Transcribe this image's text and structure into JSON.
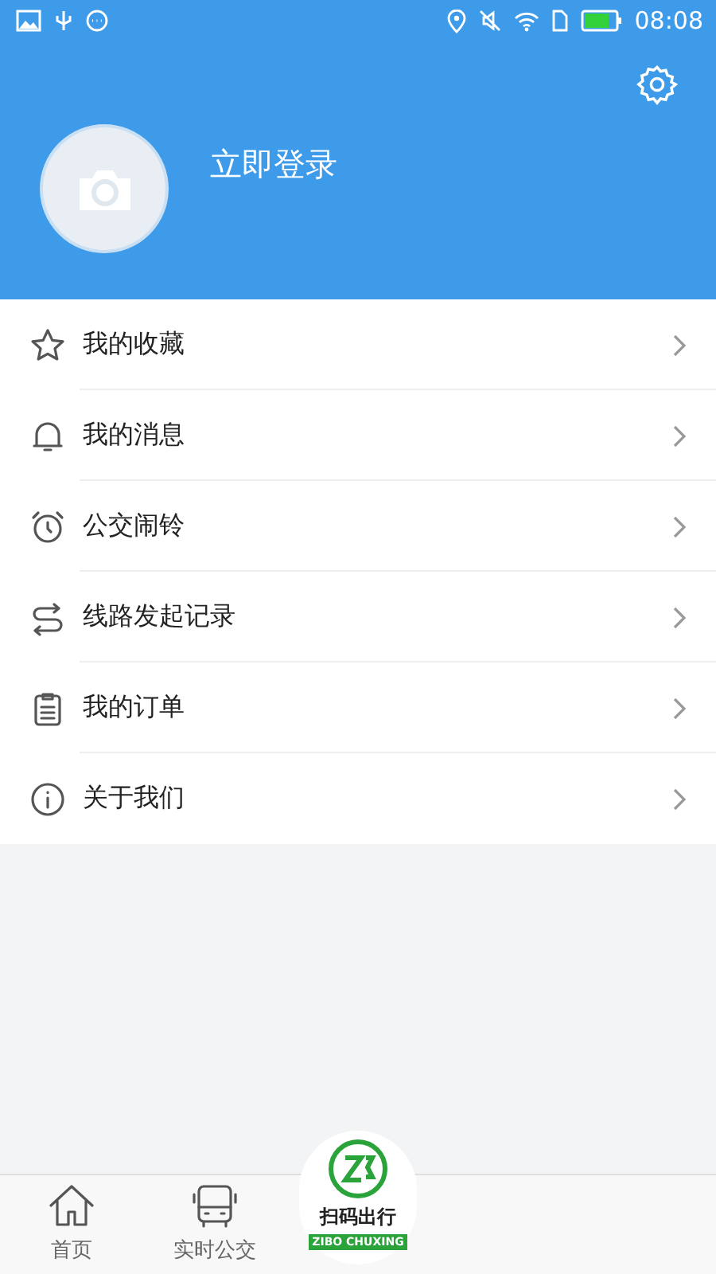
{
  "status_bar": {
    "time": "08:08"
  },
  "profile": {
    "login_label": "立即登录"
  },
  "menu": [
    {
      "kind": "star",
      "label": "我的收藏"
    },
    {
      "kind": "bell",
      "label": "我的消息"
    },
    {
      "kind": "alarm",
      "label": "公交闹铃"
    },
    {
      "kind": "swap",
      "label": "线路发起记录"
    },
    {
      "kind": "clipboard",
      "label": "我的订单"
    },
    {
      "kind": "info",
      "label": "关于我们"
    }
  ],
  "bottom_nav": [
    {
      "kind": "home",
      "label": "首页"
    },
    {
      "kind": "bus",
      "label": "实时公交"
    },
    {
      "kind": "scan",
      "label": "扫码出行",
      "sublabel": "ZIBO CHUXING"
    }
  ]
}
